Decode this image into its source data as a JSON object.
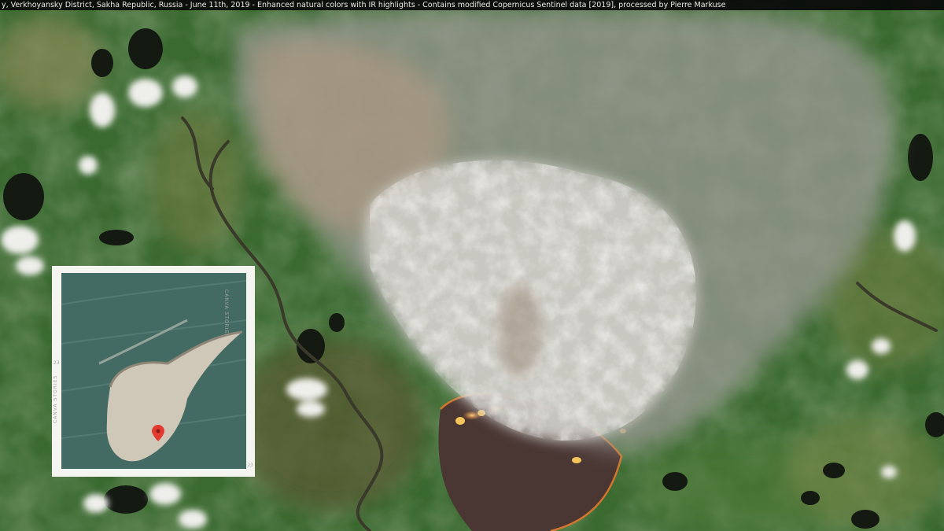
{
  "caption": "y, Verkhoyansky District, Sakha Republic, Russia - June 11th, 2019 - Enhanced natural colors with IR highlights - Contains modified Copernicus Sentinel data [2019], processed by Pierre Markuse",
  "inset": {
    "frame_text_left": "CANVA STORIES",
    "frame_text_right": "CANVA STORIES",
    "frame_marks": [
      "23",
      "23"
    ],
    "map_labels": [
      "",
      ""
    ]
  },
  "icons": {
    "map_pin": "location-pin-icon"
  },
  "colors": {
    "forest": "#3b6a31",
    "smoke": "#c9c7c2",
    "fire": "#f3a53a",
    "burn_scar": "#4a3734",
    "pin": "#e23a2e"
  }
}
